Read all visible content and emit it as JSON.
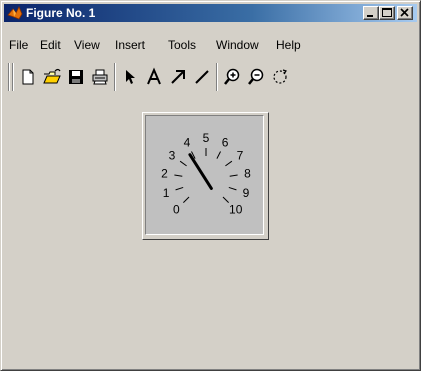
{
  "window": {
    "title": "Figure No. 1",
    "background": "#d4d0c8",
    "title_gradient_start": "#0a246a"
  },
  "title_buttons": [
    {
      "name": "minimize-button",
      "icon": "minimize-icon"
    },
    {
      "name": "maximize-button",
      "icon": "maximize-icon"
    },
    {
      "name": "close-button",
      "icon": "close-icon"
    }
  ],
  "menu": {
    "file": "File",
    "edit": "Edit",
    "view": "View",
    "insert": "Insert",
    "tools": "Tools",
    "window": "Window",
    "help": "Help"
  },
  "toolbar": {
    "icons": [
      "new-file-icon",
      "open-folder-icon",
      "save-icon",
      "print-icon",
      "arrow-select-icon",
      "text-icon",
      "arrow-icon",
      "line-icon",
      "zoom-in-icon",
      "zoom-out-icon",
      "rotate-icon"
    ]
  },
  "gauge": {
    "labels": [
      "0",
      "1",
      "2",
      "3",
      "4",
      "5",
      "6",
      "7",
      "8",
      "9",
      "10"
    ],
    "needle_value": 3.8,
    "min": 0,
    "max": 10
  }
}
